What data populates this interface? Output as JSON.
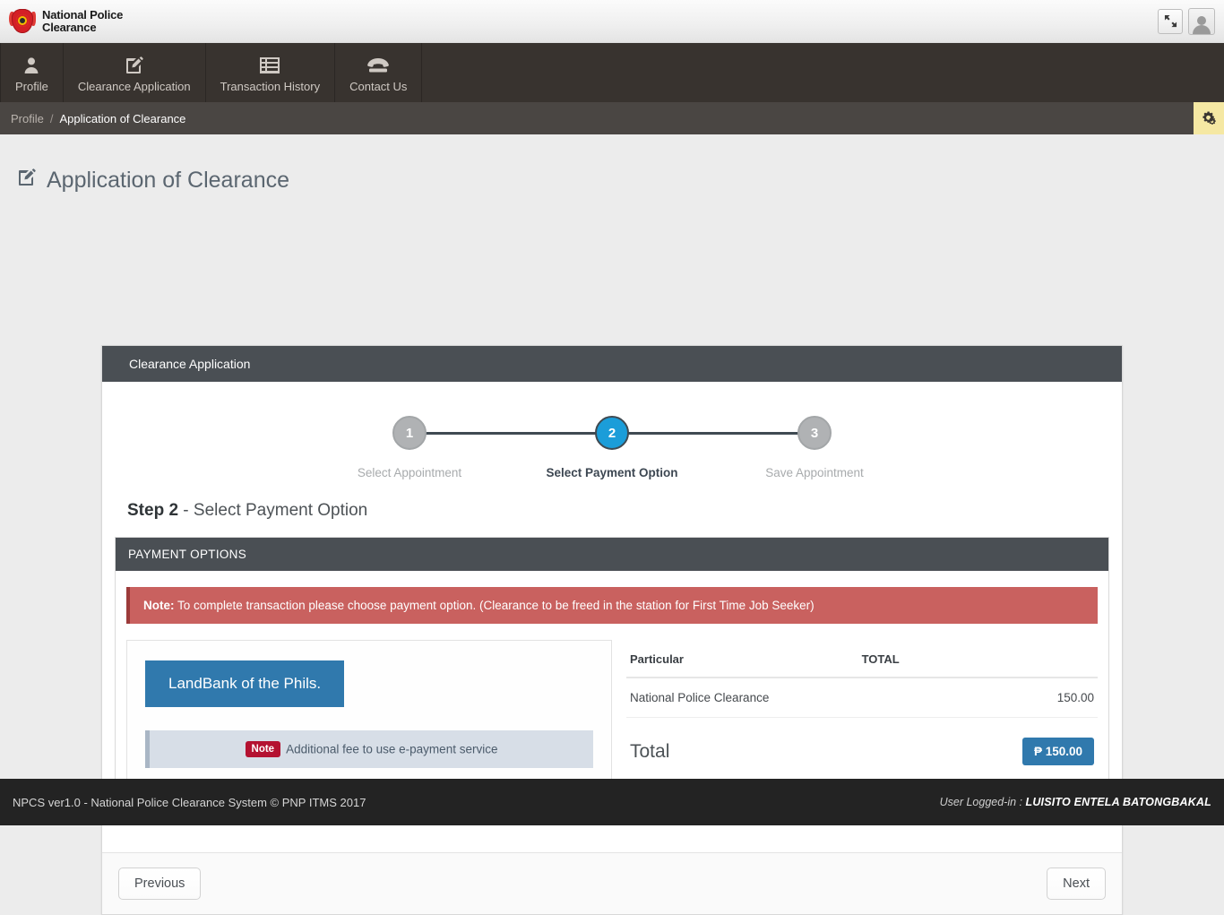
{
  "brand": {
    "line1": "National Police",
    "line2": "Clearance",
    "logo_icon": "pnp-shield-logo",
    "fullscreen_icon": "fullscreen-expand-icon",
    "avatar_icon": "user-avatar-icon"
  },
  "nav": {
    "items": [
      {
        "label": "Profile",
        "icon": "user-icon"
      },
      {
        "label": "Clearance Application",
        "icon": "pencil-square-icon"
      },
      {
        "label": "Transaction History",
        "icon": "list-table-icon"
      },
      {
        "label": "Contact Us",
        "icon": "telephone-icon"
      }
    ]
  },
  "breadcrumb": {
    "parent": "Profile",
    "separator": "/",
    "current": "Application of Clearance",
    "settings_icon": "gears-icon"
  },
  "page": {
    "title": "Application of Clearance",
    "title_icon": "pencil-square-icon"
  },
  "panel": {
    "header": "Clearance Application",
    "steps": [
      {
        "number": "1",
        "caption": "Select Appointment",
        "state": "inactive"
      },
      {
        "number": "2",
        "caption": "Select Payment Option",
        "state": "active"
      },
      {
        "number": "3",
        "caption": "Save Appointment",
        "state": "inactive"
      }
    ],
    "step_label_bold": "Step 2",
    "step_label_rest": " - Select Payment Option"
  },
  "payment": {
    "header": "PAYMENT OPTIONS",
    "note_label": "Note:",
    "note_text": " To complete transaction please choose payment option. (Clearance to be freed in the station for First Time Job Seeker)",
    "bank_button": "LandBank of the Phils.",
    "epay_badge": "Note",
    "epay_text": "Additional fee to use e-payment service"
  },
  "particulars": {
    "columns": [
      "Particular",
      "TOTAL"
    ],
    "rows": [
      {
        "particular": "National Police Clearance",
        "total": "150.00"
      }
    ],
    "total_label": "Total",
    "total_amount": "₱ 150.00"
  },
  "pager": {
    "previous": "Previous",
    "next": "Next"
  },
  "footer": {
    "left": "NPCS ver1.0 - National Police Clearance System © PNP ITMS 2017",
    "right_label": "User Logged-in : ",
    "right_user": "LUISITO ENTELA BATONGBAKAL"
  },
  "colors": {
    "navbar": "#38332f",
    "breadcrumb_bar": "#4a4643",
    "panel_header": "#4a4f54",
    "accent_blue": "#1b9dd9",
    "button_blue": "#3079ad",
    "alert_red": "#c9615f",
    "badge_red": "#b41231",
    "settings_yellow": "#f5e8a3",
    "footer_dark": "#232323"
  }
}
